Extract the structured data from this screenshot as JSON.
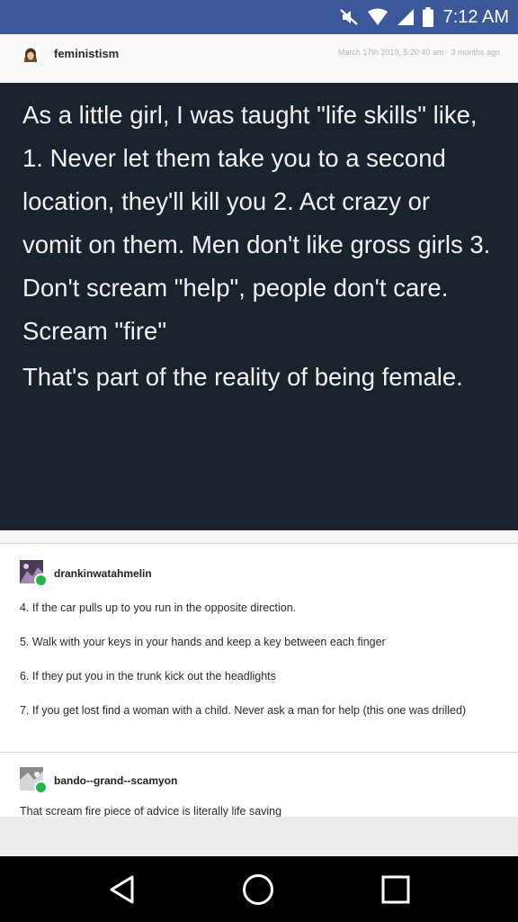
{
  "status_bar": {
    "time": "7:12 AM",
    "icons": [
      "mute-icon",
      "wifi-icon",
      "signal-icon",
      "battery-icon"
    ],
    "background": "#3b5998"
  },
  "post": {
    "username": "feministism",
    "date": "March 17th 2019, 5:20:40 am · 3 months ago",
    "text_paragraph_1": "As a little girl, I was taught \"life skills\" like, 1. Never let them take you to a second location, they'll kill you 2. Act crazy or vomit on them. Men don't like gross girls 3. Don't scream \"help\", people don't care. Scream \"fire\"",
    "text_paragraph_2": "That's part of the reality of being female.",
    "text_block_background": "#1a222c"
  },
  "reblogs": [
    {
      "username": "drankinwatahmelin",
      "items": [
        "4. If the car pulls up to you run in the opposite direction.",
        "5. Walk with your keys in your hands and keep a key between each finger",
        "6. If they put you in the trunk kick out the headlights",
        "7. If you get lost find a woman with a child. Never ask a man for help (this one was drilled)"
      ]
    },
    {
      "username": "bando--grand--scamyon",
      "text": "That scream fire piece of advice is literally life saving"
    }
  ],
  "nav_bar": {
    "icons": [
      "back-icon",
      "home-icon",
      "recent-apps-icon"
    ]
  }
}
